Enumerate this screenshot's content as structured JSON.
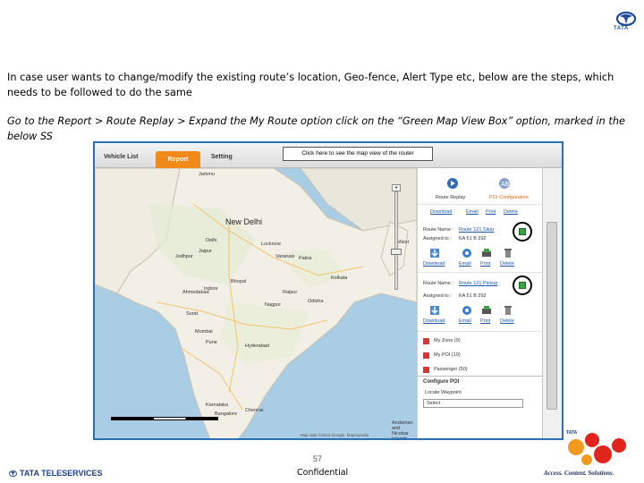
{
  "header": {
    "brand_short": "TATA"
  },
  "body": {
    "paragraph1": "In case user wants to change/modify the existing route’s location, Geo-fence, Alert Type etc, below are the steps, which needs to be followed to do the same",
    "paragraph2": "Go to the Report > Route Replay > Expand the My Route option click on the “Green Map View Box” option, marked in the below SS"
  },
  "screenshot": {
    "tabs": [
      "Vehicle List",
      "Report",
      "Setting"
    ],
    "active_tab": "Report",
    "callout": "Click here to see the map view of the router",
    "map": {
      "cities": {
        "new_delhi": "New Delhi",
        "delhi_small": "Delhi",
        "jammu": "Jammu",
        "jaipur": "Jaipur",
        "jodhpur": "Jodhpur",
        "lucknow": "Lucknow",
        "ahmedabad": "Ahmedabad",
        "bhopal": "Bhopal",
        "surat": "Surat",
        "mumbai": "Mumbai",
        "pune": "Pune",
        "nagpur": "Nagpur",
        "hyderabad": "Hyderabad",
        "bangalore": "Bangalore",
        "chennai": "Chennai",
        "kolkata": "Kolkata",
        "patna": "Patna",
        "karnataka": "Karnataka",
        "odisha": "Odisha",
        "mizor": "Mizor",
        "andaman": "Andaman and Nicobar Islands",
        "varanasi": "Varanasi",
        "indore": "Indore",
        "raipur": "Raipur"
      },
      "copyright": "Map data ©2013 Google, MapmyIndia"
    },
    "panel": {
      "route_replay": "Route Replay",
      "poi_configuration": "POI Configuration",
      "row_actions": [
        "Download",
        "Email",
        "Print",
        "Delete"
      ],
      "route_name_label": "Route Name :",
      "route_1_value": "Route 121 Sikar",
      "route_2_value": "Route 121 Pickup",
      "assigned_label": "Assigned to :",
      "assigned_value_1": "KA 51 B 292",
      "assigned_value_2": "KA 51 B 292",
      "my_zone": "My Zone (9)",
      "my_poi": "My POI (10)",
      "passenger": "Passenger (50)",
      "configure_poi": "Configure POI",
      "locate_waypoint": "Locate Waypoint",
      "select_placeholder": "Select"
    }
  },
  "footer": {
    "page_number": "57",
    "confidential": "Confidential",
    "company": "TATA TELESERVICES",
    "tagline": "Access. Content. Solutions.",
    "docomo_tata": "TATA"
  },
  "colors": {
    "accent_blue": "#2b6fb5",
    "report_tab_orange": "#f08a1a",
    "docomo_red": "#e0241b",
    "docomo_orange": "#f39a1e",
    "tata_blue": "#1f3f88"
  }
}
